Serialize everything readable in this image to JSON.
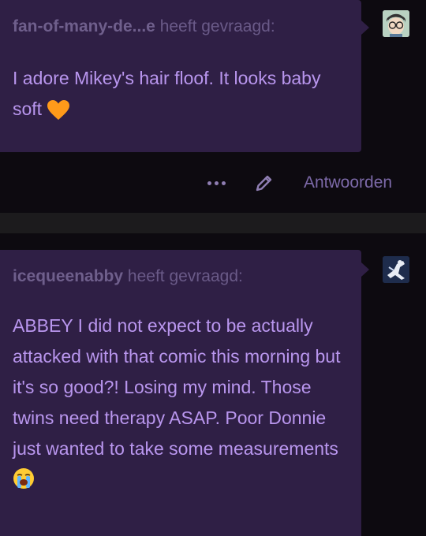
{
  "posts": [
    {
      "asker": "fan-of-many-de...e",
      "asked_suffix": "heeft gevraagd:",
      "question": "I adore Mikey's hair floof. It looks baby soft",
      "emoji": "orange-heart"
    },
    {
      "asker": "icequeenabby",
      "asked_suffix": "heeft gevraagd:",
      "question": "ABBEY I did not expect to be actually attacked with that comic this morning but it's so good?! Losing my mind. Those twins need therapy ASAP. Poor Donnie just wanted to take some measurements",
      "emoji": "loudly-crying-face"
    }
  ],
  "actions": {
    "more_icon": "ellipsis-icon",
    "edit_icon": "pencil-icon",
    "reply_label": "Antwoorden"
  },
  "colors": {
    "card_bg": "#2f1f45",
    "page_bg": "#0d0a10",
    "question_text": "#b996ee",
    "asker_text": "#6a5a88",
    "accent": "#7c69a8"
  }
}
